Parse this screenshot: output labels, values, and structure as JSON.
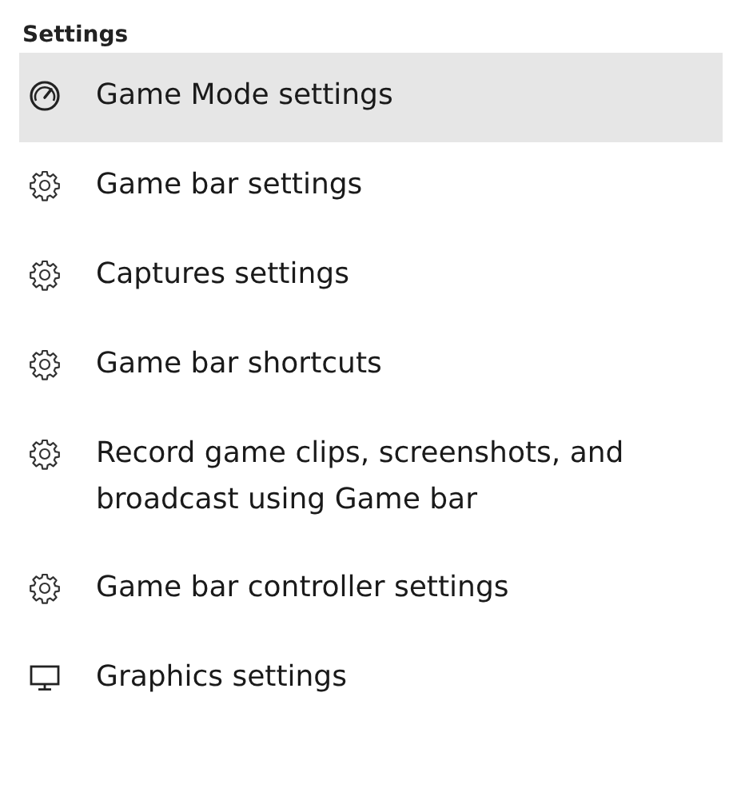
{
  "heading": "Settings",
  "items": [
    {
      "label": "Game Mode settings",
      "kind": "gauge",
      "selected": true
    },
    {
      "label": "Game bar settings",
      "kind": "gear",
      "selected": false
    },
    {
      "label": "Captures settings",
      "kind": "gear",
      "selected": false
    },
    {
      "label": "Game bar shortcuts",
      "kind": "gear",
      "selected": false
    },
    {
      "label": "Record game clips, screenshots, and broadcast using Game bar",
      "kind": "gear",
      "selected": false
    },
    {
      "label": "Game bar controller settings",
      "kind": "gear",
      "selected": false
    },
    {
      "label": "Graphics settings",
      "kind": "monitor",
      "selected": false
    }
  ]
}
